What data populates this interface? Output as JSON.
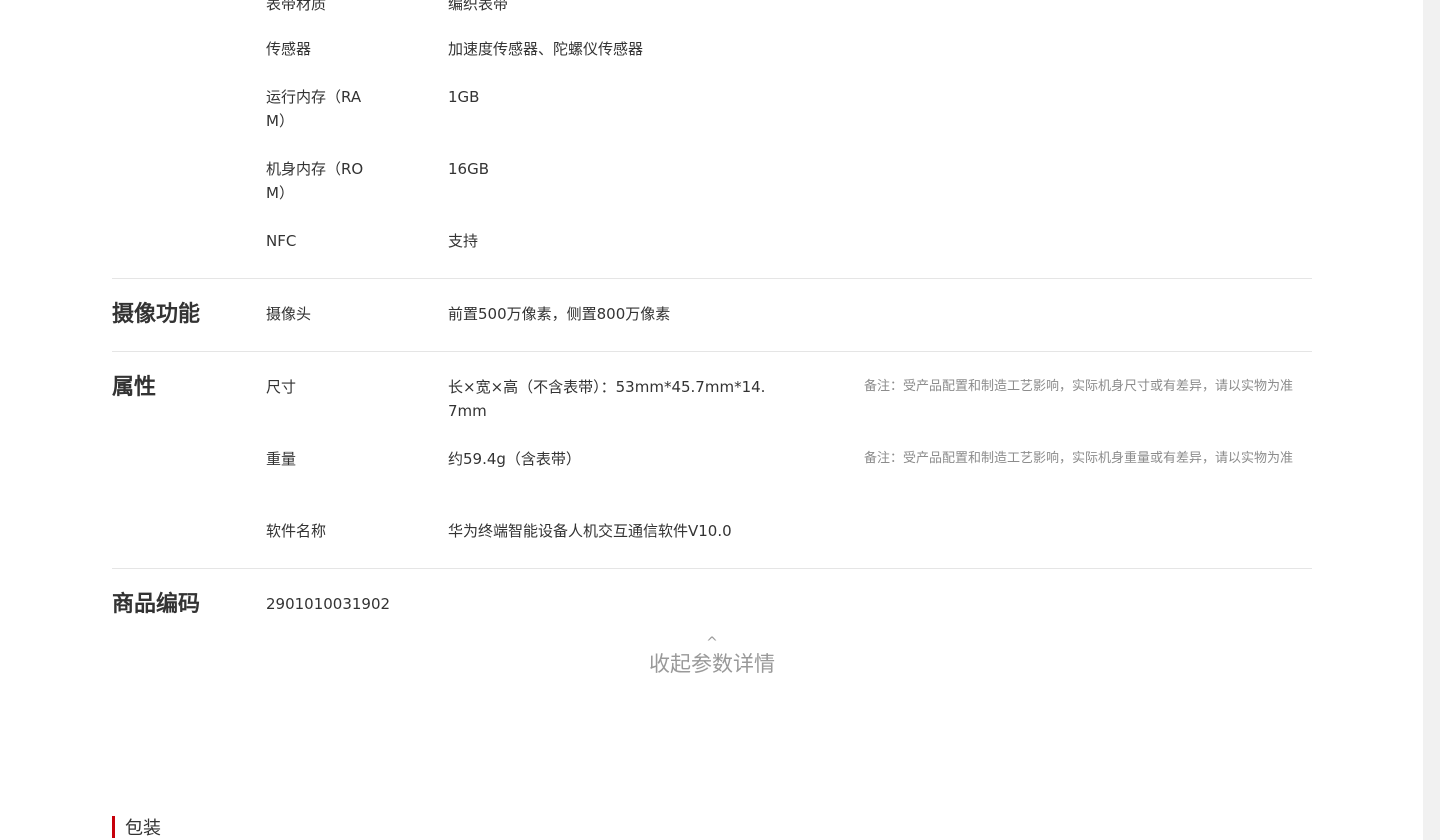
{
  "specs_top": [
    {
      "key": "表带材质",
      "value": "编织表带"
    },
    {
      "key": "传感器",
      "value": "加速度传感器、陀螺仪传感器"
    },
    {
      "key": "运行内存（RAM）",
      "value": "1GB"
    },
    {
      "key": "机身内存（ROM）",
      "value": "16GB"
    },
    {
      "key": "NFC",
      "value": "支持"
    }
  ],
  "camera": {
    "title": "摄像功能",
    "rows": [
      {
        "key": "摄像头",
        "value": "前置500万像素，侧置800万像素"
      }
    ]
  },
  "attributes": {
    "title": "属性",
    "rows": [
      {
        "key": "尺寸",
        "value": "长×宽×高（不含表带）：53mm*45.7mm*14.7mm",
        "note": "备注：受产品配置和制造工艺影响，实际机身尺寸或有差异，请以实物为准"
      },
      {
        "key": "重量",
        "value": "约59.4g（含表带）",
        "note": "备注：受产品配置和制造工艺影响，实际机身重量或有差异，请以实物为准"
      },
      {
        "key": "软件名称",
        "value": "华为终端智能设备人机交互通信软件V10.0"
      }
    ]
  },
  "product_code": {
    "title": "商品编码",
    "value": "2901010031902"
  },
  "collapse": {
    "caret": "^",
    "label": "收起参数详情"
  },
  "packing": {
    "label": "包装",
    "accent_color": "#c7000b"
  }
}
